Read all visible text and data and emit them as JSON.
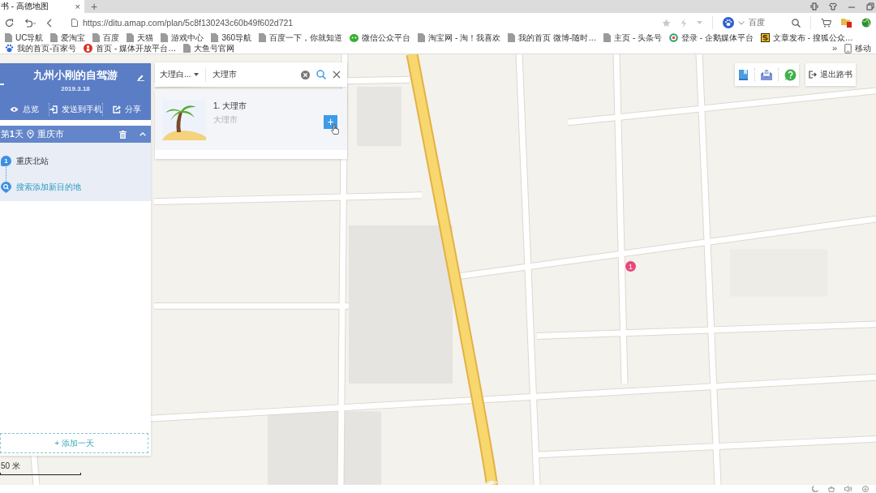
{
  "browser": {
    "tabs": [
      {
        "title": "书 - 高德地图",
        "close": "×",
        "selected": true
      }
    ],
    "new_tab": "+",
    "url": "https://ditu.amap.com/plan/5c8f130243c60b49f602d721",
    "search_engine": "百度",
    "bookmarks": [
      {
        "label": "UC导航",
        "kind": "page"
      },
      {
        "label": "爱淘宝",
        "kind": "page"
      },
      {
        "label": "百度",
        "kind": "page"
      },
      {
        "label": "天猫",
        "kind": "page"
      },
      {
        "label": "游戏中心",
        "kind": "page"
      },
      {
        "label": "360导航",
        "kind": "page"
      },
      {
        "label": "百度一下，你就知道",
        "kind": "page"
      },
      {
        "label": "微信公众平台",
        "kind": "chat"
      },
      {
        "label": "淘宝网 - 淘！我喜欢",
        "kind": "page"
      },
      {
        "label": "我的首页 微博-随时…",
        "kind": "page"
      },
      {
        "label": "主页 - 头条号",
        "kind": "page"
      },
      {
        "label": "登录 - 企鹅媒体平台",
        "kind": "ring"
      },
      {
        "label": "文章发布 - 搜狐公众…",
        "kind": "square"
      },
      {
        "label": "我的首页-百家号",
        "kind": "paw"
      },
      {
        "label": "首页 - 媒体开放平台…",
        "kind": "dot"
      },
      {
        "label": "大鱼号官网",
        "kind": "page"
      }
    ],
    "overflow": {
      "more": "»",
      "label": "移动",
      "kind": "device"
    }
  },
  "route_panel": {
    "title": "九州小刚的自驾游",
    "date": "2019.3.18",
    "actions": [
      {
        "label": "总览",
        "kind": "eye"
      },
      {
        "label": "发送到手机",
        "kind": "send"
      },
      {
        "label": "分享",
        "kind": "share"
      }
    ],
    "days": [
      {
        "label": "第**1**天",
        "city": "重庆市",
        "expanded": true,
        "stops": [
          {
            "number": "1",
            "name": "重庆北站"
          }
        ],
        "add_stop": "搜索添加新目的地"
      }
    ],
    "add_day": "+ 添加一天"
  },
  "search_panel": {
    "city_filter": "大理白...",
    "query": "大理市",
    "results": [
      {
        "title": "1. 大理市",
        "subtitle": "大理市",
        "add": "+"
      }
    ]
  },
  "map_toolbar": {
    "buttons": [
      {
        "kind": "bookmark"
      },
      {
        "kind": "mail"
      },
      {
        "kind": "help"
      }
    ],
    "exit": "退出路书"
  },
  "map": {
    "markers": [
      {
        "label": "1"
      }
    ],
    "scale": "50 米"
  }
}
